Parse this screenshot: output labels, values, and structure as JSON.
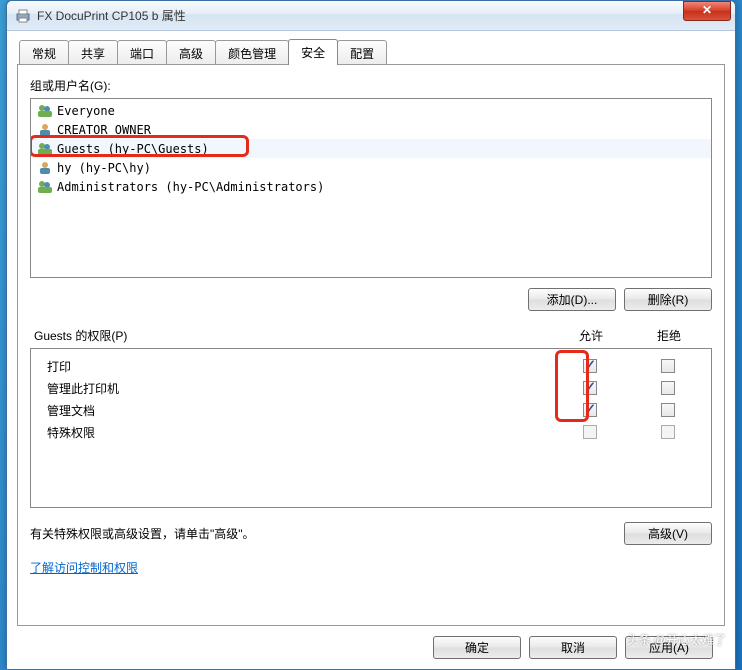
{
  "window": {
    "title": "FX DocuPrint CP105 b 属性"
  },
  "tabs": [
    "常规",
    "共享",
    "端口",
    "高级",
    "颜色管理",
    "安全",
    "配置"
  ],
  "activeTabIndex": 5,
  "usersLabel": "组或用户名(G):",
  "users": [
    {
      "name": "Everyone"
    },
    {
      "name": "CREATOR OWNER"
    },
    {
      "name": "Guests (hy-PC\\Guests)",
      "selected": true
    },
    {
      "name": "hy (hy-PC\\hy)"
    },
    {
      "name": "Administrators (hy-PC\\Administrators)"
    }
  ],
  "buttons": {
    "add": "添加(D)...",
    "remove": "删除(R)",
    "advanced": "高级(V)",
    "ok": "确定",
    "cancel": "取消",
    "apply": "应用(A)"
  },
  "permHeader": {
    "title": "Guests 的权限(P)",
    "allow": "允许",
    "deny": "拒绝"
  },
  "perms": [
    {
      "name": "打印",
      "allow": true,
      "deny": false
    },
    {
      "name": "管理此打印机",
      "allow": true,
      "deny": false
    },
    {
      "name": "管理文档",
      "allow": true,
      "deny": false
    },
    {
      "name": "特殊权限",
      "allow": false,
      "allowDim": true,
      "deny": false,
      "denyDim": true
    }
  ],
  "advText": "有关特殊权限或高级设置，请单击\"高级\"。",
  "link": "了解访问控制和权限",
  "watermark": "头条 @开心太难了"
}
